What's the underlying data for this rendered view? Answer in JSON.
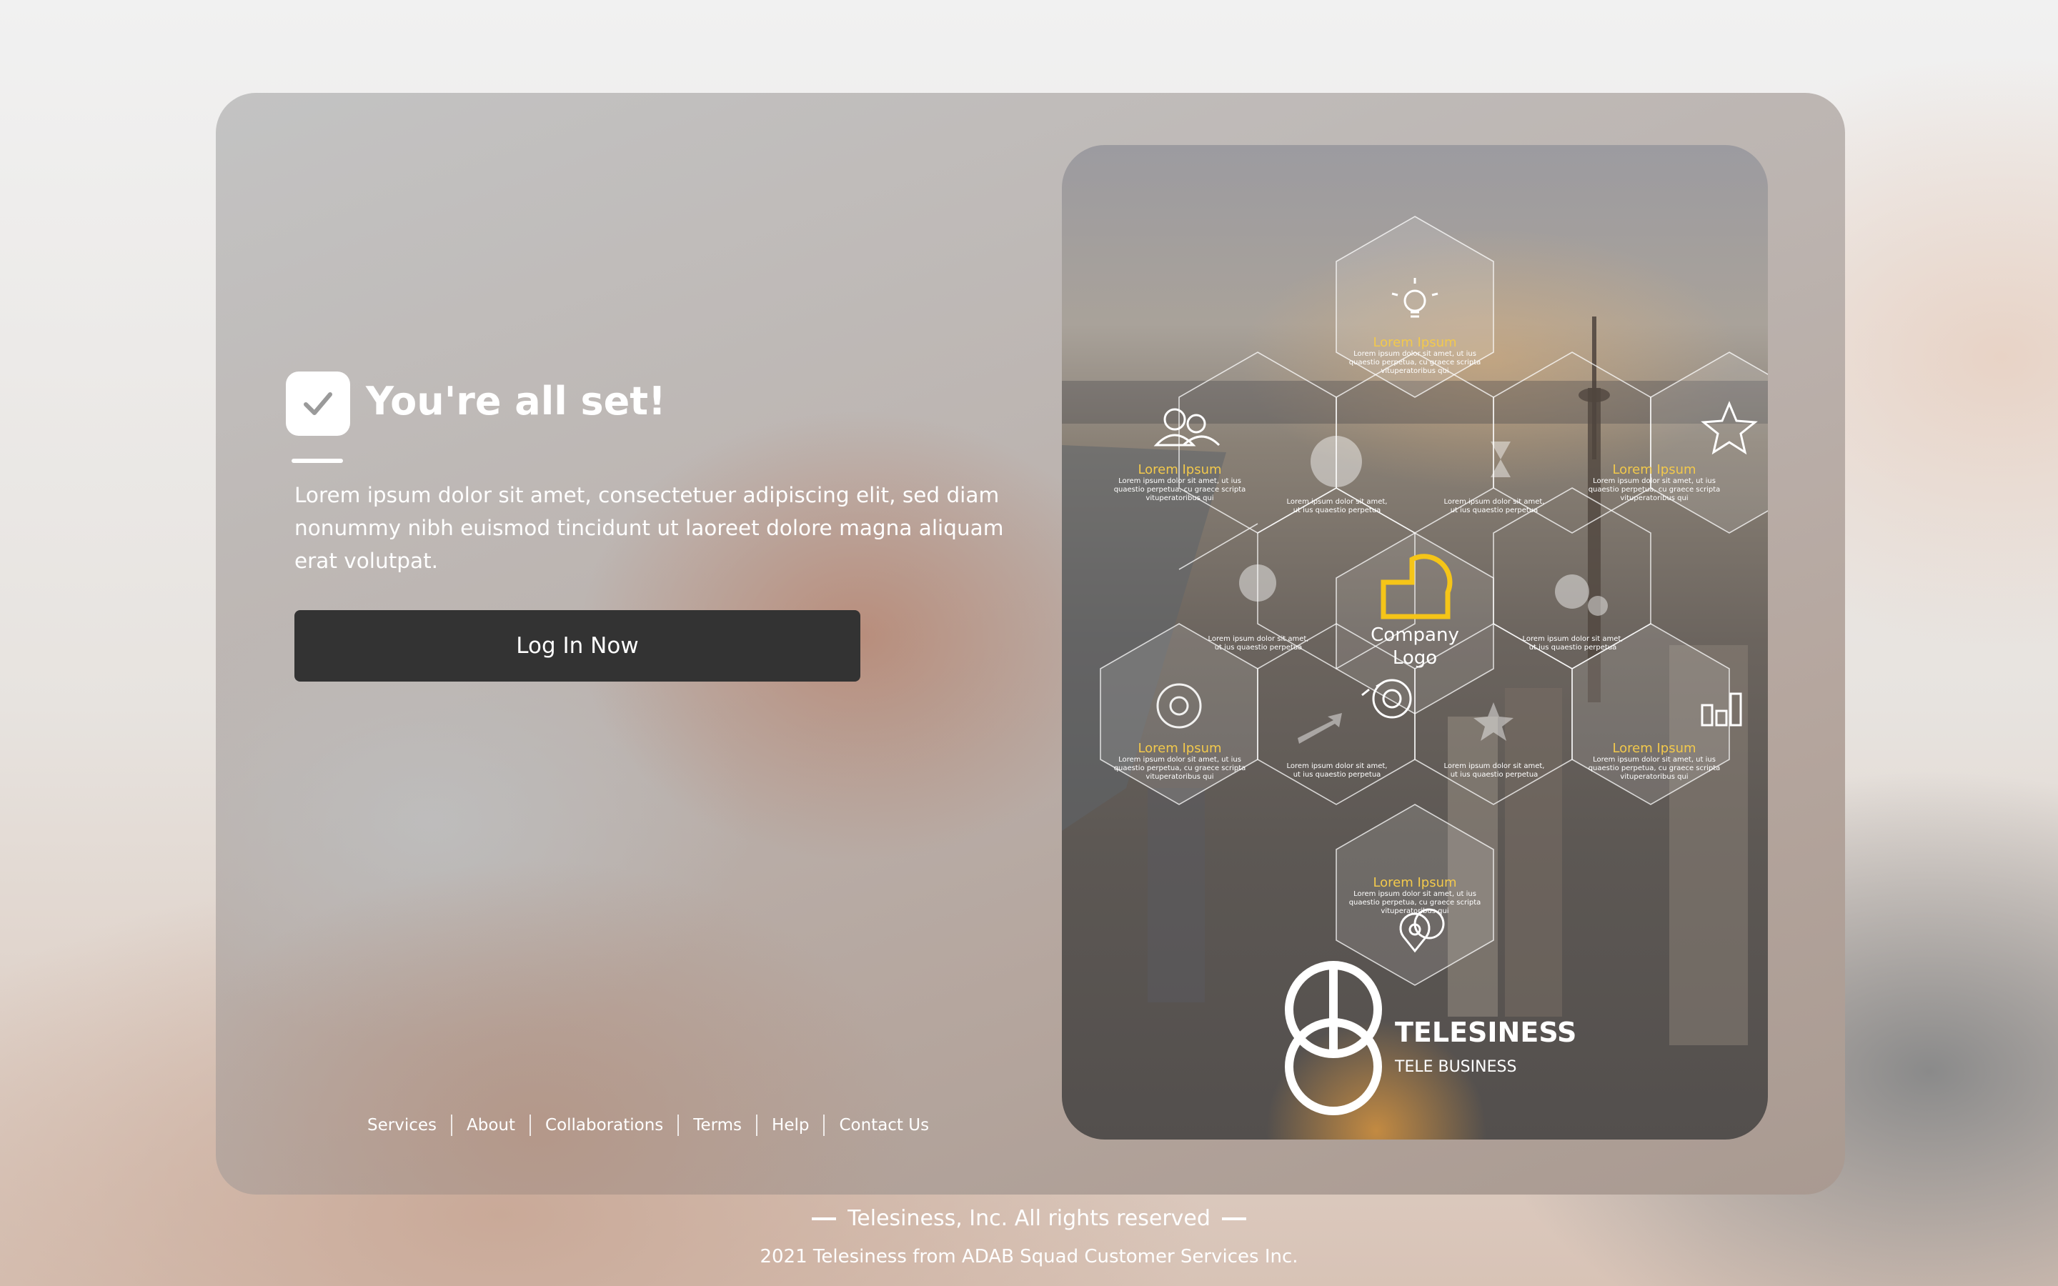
{
  "hero": {
    "title": "You're all set!",
    "description": "Lorem ipsum dolor sit amet, consectetuer adipiscing elit, sed diam nonummy nibh euismod tincidunt ut laoreet dolore magna aliquam erat volutpat.",
    "login_label": "Log In Now"
  },
  "nav_links": [
    "Services",
    "About",
    "Collaborations",
    "Terms",
    "Help",
    "Contact Us"
  ],
  "infographic": {
    "hex_title": "Lorem Ipsum",
    "hex_body": "Lorem ipsum dolor sit amet, ut ius quaestio perpetua, cu graece scripta vituperatoribus qui",
    "small_body": "Lorem ipsum dolor sit amet, ut ius quaestio perpetua",
    "center_label_line1": "Company",
    "center_label_line2": "Logo",
    "brand_name": "TELESINESS",
    "brand_sub": "TELE BUSINESS",
    "accent_color": "#f5c518"
  },
  "footer": {
    "rights": "Telesiness, Inc. All rights reserved",
    "note": "2021 Telesiness from ADAB Squad Customer Services Inc."
  }
}
